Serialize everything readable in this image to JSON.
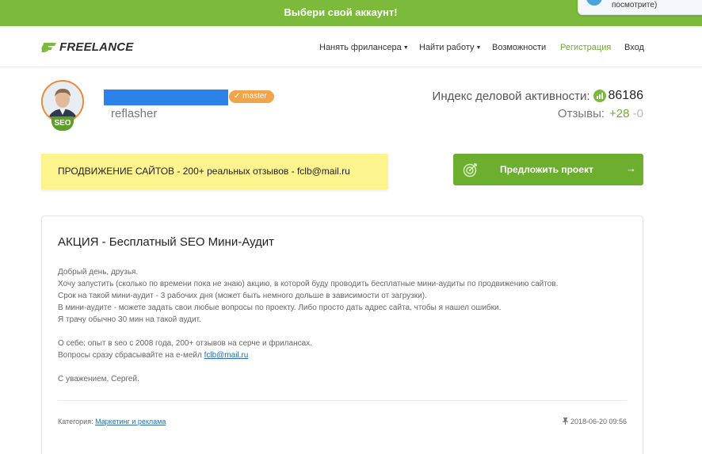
{
  "topbar": {
    "title": "Выбери свой аккаунт!",
    "tooltip_text": "посмотрите)"
  },
  "header": {
    "logo_text": "FREELANCE",
    "nav": [
      {
        "label": "Нанять фрилансера",
        "has_caret": true
      },
      {
        "label": "Найти работу",
        "has_caret": true
      },
      {
        "label": "Возможности",
        "has_caret": false
      },
      {
        "label": "Регистрация",
        "has_caret": false
      },
      {
        "label": "Вход",
        "has_caret": false
      }
    ]
  },
  "profile": {
    "badge": "SEO",
    "rank": "master",
    "username": "reflasher",
    "activity_label": "Индекс деловой активности:",
    "activity_value": "86186",
    "reviews_label": "Отзывы:",
    "reviews_positive": "+28",
    "reviews_negative": "-0"
  },
  "banner": {
    "text": "ПРОДВИЖЕНИЕ САЙТОВ - 200+ реальных отзывов - fclb@mail.ru"
  },
  "cta": {
    "label": "Предложить проект",
    "arrow": "→"
  },
  "post": {
    "title": "АКЦИЯ - Бесплатный SEO Мини-Аудит",
    "lines": [
      "Добрый день, друзья.",
      "Хочу запустить (сколько по времени пока не знаю) акцию, в которой буду проводить бесплатные мини-аудиты по продвижению сайтов.",
      "Срок на такой мини-аудит - 3 рабочих дня (может быть немного дольше в зависимости от загрузки).",
      "В мини-аудите - можете задать свои любые вопросы по проекту. Либо просто дать адрес сайта, чтобы я нашел ошибки.",
      "Я трачу обычно 30 мин на такой аудит."
    ],
    "about": "О себе: опыт в seo с 2008 года, 200+ отзывов на серче и фрилансах.",
    "contact_prefix": "Вопросы сразу сбрасывайте на е-мейл ",
    "contact_email": "fclb@mail.ru",
    "signature": "С уважением, Сергей.",
    "category_label": "Категория: ",
    "category_value": "Маркетинг и реклама",
    "date": "2018-06-20 09:56"
  },
  "colors": {
    "brand_green": "#7cba3b",
    "button_green": "#6cae2e",
    "banner_yellow": "#fdf48e",
    "badge_orange": "#f0a54a",
    "link_blue": "#2a6fb5"
  }
}
